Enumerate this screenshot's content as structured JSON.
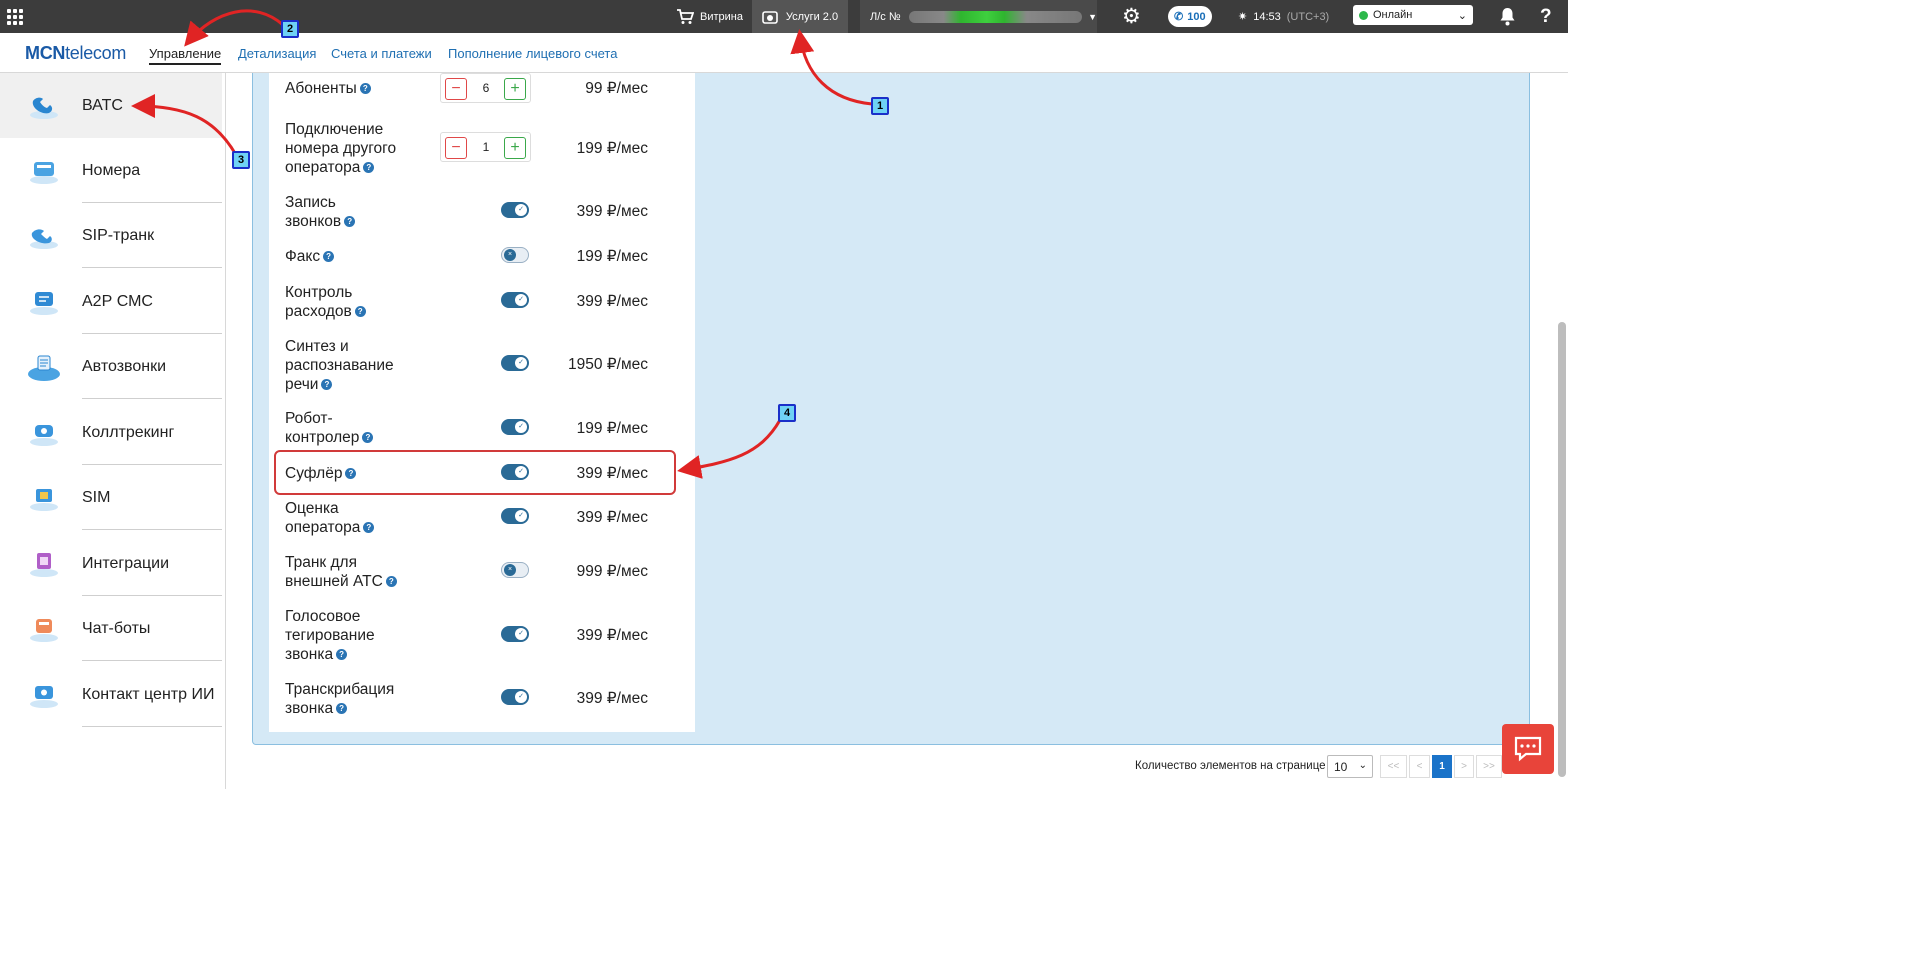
{
  "topbar": {
    "vitrina": "Витрина",
    "uslugi": "Услуги 2.0",
    "account_prefix": "Л/с №",
    "calls_count": "100",
    "time": "14:53",
    "timezone": "(UTC+3)",
    "status": "Онлайн",
    "help": "?"
  },
  "nav": {
    "logo_bold": "MCN",
    "logo_rest": "telecom",
    "links": [
      "Управление",
      "Детализация",
      "Счета и платежи",
      "Пополнение лицевого счета"
    ]
  },
  "sidebar": {
    "items": [
      "ВАТС",
      "Номера",
      "SIP-транк",
      "А2Р СМС",
      "Автозвонки",
      "Коллтрекинг",
      "SIM",
      "Интеграции",
      "Чат-боты",
      "Контакт центр ИИ"
    ]
  },
  "services": [
    {
      "label": "Абоненты",
      "control": "stepper",
      "value": "6",
      "price": "99 ₽/мес"
    },
    {
      "label": "Подключение номера другого оператора",
      "control": "stepper",
      "value": "1",
      "price": "199 ₽/мес"
    },
    {
      "label": "Запись звонков",
      "control": "toggle",
      "on": true,
      "price": "399 ₽/мес"
    },
    {
      "label": "Факс",
      "control": "toggle",
      "on": false,
      "price": "199 ₽/мес"
    },
    {
      "label": "Контроль расходов",
      "control": "toggle",
      "on": true,
      "price": "399 ₽/мес"
    },
    {
      "label": "Синтез и распознавание речи",
      "control": "toggle",
      "on": true,
      "price": "1950 ₽/мес"
    },
    {
      "label": "Робот-контролер",
      "control": "toggle",
      "on": true,
      "price": "199 ₽/мес"
    },
    {
      "label": "Суфлёр",
      "control": "toggle",
      "on": true,
      "price": "399 ₽/мес"
    },
    {
      "label": "Оценка оператора",
      "control": "toggle",
      "on": true,
      "price": "399 ₽/мес"
    },
    {
      "label": "Транк для внешней АТС",
      "control": "toggle",
      "on": false,
      "price": "999 ₽/мес"
    },
    {
      "label": "Голосовое тегирование звонка",
      "control": "toggle",
      "on": true,
      "price": "399 ₽/мес"
    },
    {
      "label": "Транскрибация звонка",
      "control": "toggle",
      "on": true,
      "price": "399 ₽/мес"
    }
  ],
  "annotations": [
    "1",
    "2",
    "3",
    "4"
  ],
  "pagination": {
    "label": "Количество элементов на странице",
    "per_page": "10",
    "first": "<<",
    "prev": "<",
    "page": "1",
    "next": ">",
    "last": ">>"
  },
  "colors": {
    "topbar": "#3c3c3c",
    "link": "#1f6fb2",
    "content_bg": "#d5e9f6",
    "toggle_on": "#2a6a96",
    "highlight": "#d13a3a",
    "chat": "#e8443a"
  }
}
